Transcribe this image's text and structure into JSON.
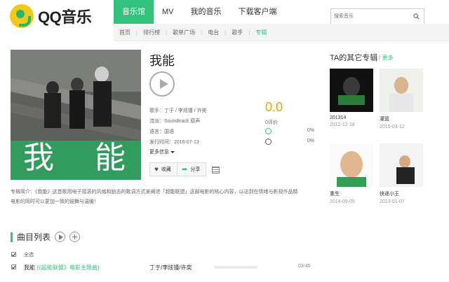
{
  "header": {
    "logo_text": "QQ音乐",
    "nav": [
      "音乐馆",
      "MV",
      "我的音乐",
      "下载客户端"
    ],
    "subnav": [
      "首页",
      "排行榜",
      "歌单广场",
      "电台",
      "歌手",
      "专辑"
    ],
    "search_placeholder": "搜索音乐"
  },
  "album": {
    "title": "我能",
    "cover_title": "我 能",
    "meta": [
      {
        "key": "歌手：",
        "value": "丁于 / 李炫锺 / 许奕"
      },
      {
        "key": "流派：",
        "value": "Soundtrack 原声"
      },
      {
        "key": "语言：",
        "value": "国语"
      },
      {
        "key": "发行时间：",
        "value": "2016-07-13"
      }
    ],
    "more_info": "更多信息",
    "score": "0.0",
    "score_sub": "0评价",
    "ratings": [
      {
        "pct": "0%"
      },
      {
        "pct": "0%"
      }
    ],
    "actions": {
      "collect": "收藏",
      "share": "分享"
    },
    "description_lines": [
      "专辑简介：《我能》这首歌用电子摇滚的风格和励志的歌词方式来阐述「超能联盟」这部电影的核心内容，以达到在情绪与影视作品精",
      "电影的同时可以更加一致的鼓舞与温暖！"
    ]
  },
  "other_albums": {
    "title": "TA的其它专辑",
    "more": "/ 更多",
    "items": [
      {
        "name": "201314",
        "date": "2012-12-18"
      },
      {
        "name": "灌篮",
        "date": "2015-03-12"
      },
      {
        "name": "重生",
        "date": "2014-09-05"
      },
      {
        "name": "快递小王",
        "date": "2013-01-07"
      }
    ]
  },
  "songlist": {
    "title": "曲目列表",
    "select_all": "全选",
    "songs": [
      {
        "title": "我能",
        "subtitle": "(《超能联盟》电影主题曲)",
        "singer": "丁于/李炫锺/许奕",
        "duration": "03:40"
      }
    ]
  }
}
